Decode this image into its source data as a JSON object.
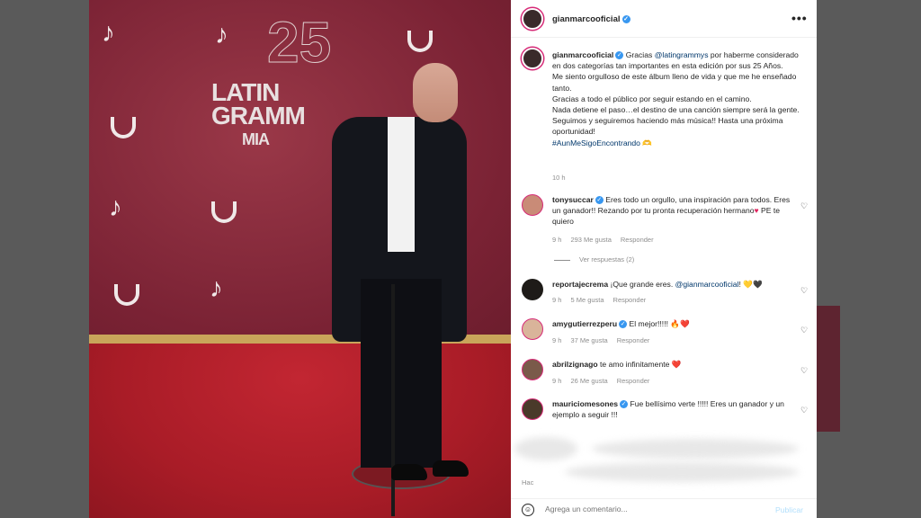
{
  "photo": {
    "logo_line1": "LATIN",
    "logo_line2": "GRAMM",
    "logo_line3": "MIA",
    "logo_number": "25"
  },
  "post": {
    "header_username": "gianmarcooficial",
    "more_label": "•••",
    "caption_user": "gianmarcooficial",
    "caption_l1a": "Gracias ",
    "caption_mention": "@latingrammys",
    "caption_l1b": " por haberme considerado en dos categorías tan importantes en esta edición por sus 25 Años.",
    "caption_l2": "Me siento orgulloso de este álbum lleno de vida y que me he enseñado tanto.",
    "caption_l3": "Gracias a todo el público por seguir estando en el camino.",
    "caption_l4": "Nada detiene el paso…el destino de una canción siempre será la gente.",
    "caption_l5": "Seguimos y seguiremos haciendo más música!! Hasta una próxima oportunidad!",
    "hashtag": "#AunMeSigoEncontrando",
    "time": "10 h"
  },
  "comments": [
    {
      "user": "tonysuccar",
      "text": "Eres todo un orgullo, una inspiración para todos. Eres un ganador!! Rezando por tu pronta recuperación hermano",
      "text_tail": " PE te quiero",
      "time": "9 h",
      "likes": "293 Me gusta",
      "reply": "Responder",
      "verified": true
    },
    {
      "user": "reportajecrema",
      "text": "¡Que grande eres. ",
      "mention": "@gianmarcooficial",
      "text_tail": "! 💛🖤",
      "time": "9 h",
      "likes": "5 Me gusta",
      "reply": "Responder",
      "verified": false
    },
    {
      "user": "amygutierrezperu",
      "text": "El mejor!!!!! 🔥❤️",
      "time": "9 h",
      "likes": "37 Me gusta",
      "reply": "Responder",
      "verified": true
    },
    {
      "user": "abrilzignago",
      "text": "te amo infinitamente ❤️",
      "time": "9 h",
      "likes": "26 Me gusta",
      "reply": "Responder",
      "verified": false
    },
    {
      "user": "mauriciomesones",
      "text": "Fue bellísimo verte !!!!! Eres un ganador y un ejemplo a seguir !!!",
      "verified": true
    }
  ],
  "view_replies": "Ver respuestas (2)",
  "blur_label": "Hac",
  "footer": {
    "placeholder": "Agrega un comentario...",
    "publish": "Publicar"
  },
  "colors": {
    "link": "#00376b",
    "verified": "#3897f0",
    "publish": "#b2dffc"
  }
}
